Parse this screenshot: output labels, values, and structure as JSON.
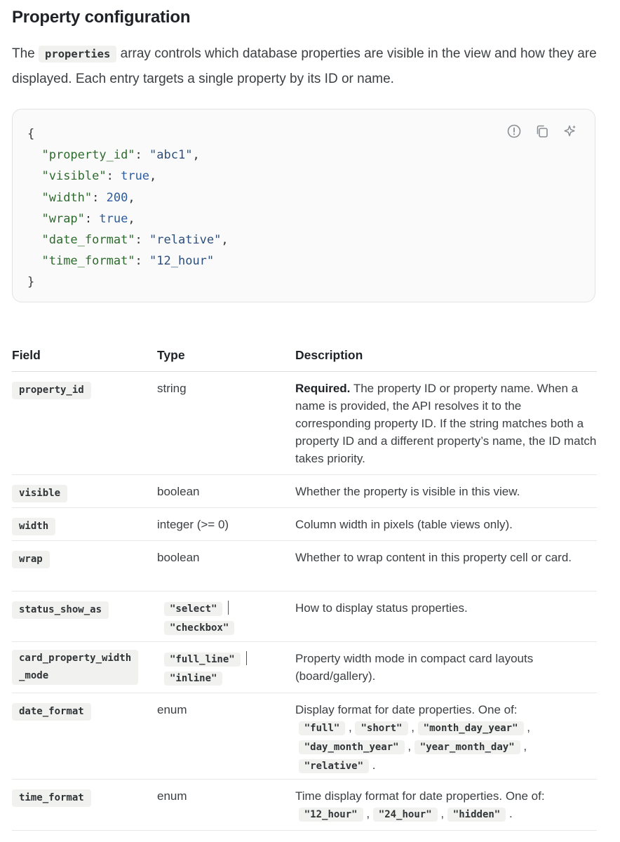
{
  "heading": "Property configuration",
  "intro": {
    "before": "The",
    "code": "properties",
    "after": "array controls which database properties are visible in the view and how they are displayed. Each entry targets a single property by its ID or name."
  },
  "code_block": {
    "open": "{",
    "close": "}",
    "lines": [
      {
        "key": "\"property_id\"",
        "value": "\"abc1\"",
        "type": "string",
        "comma": ","
      },
      {
        "key": "\"visible\"",
        "value": "true",
        "type": "number",
        "comma": ","
      },
      {
        "key": "\"width\"",
        "value": "200",
        "type": "number",
        "comma": ","
      },
      {
        "key": "\"wrap\"",
        "value": "true",
        "type": "number",
        "comma": ","
      },
      {
        "key": "\"date_format\"",
        "value": "\"relative\"",
        "type": "string",
        "comma": ","
      },
      {
        "key": "\"time_format\"",
        "value": "\"12_hour\"",
        "type": "string",
        "comma": ""
      }
    ],
    "icons": [
      "info-icon",
      "copy-icon",
      "sparkle-icon"
    ]
  },
  "table": {
    "headers": {
      "field": "Field",
      "type": "Type",
      "description": "Description"
    },
    "rows": {
      "property_id": {
        "field": "property_id",
        "type": "string",
        "required": "Required.",
        "description": "The property ID or property name. When a name is provided, the API resolves it to the corresponding property ID. If the string matches both a property ID and a different property’s name, the ID match takes priority."
      },
      "visible": {
        "field": "visible",
        "type": "boolean",
        "description": "Whether the property is visible in this view."
      },
      "width": {
        "field": "width",
        "type": "integer (>= 0)",
        "description": "Column width in pixels (table views only)."
      },
      "wrap": {
        "field": "wrap",
        "type": "boolean",
        "description": "Whether to wrap content in this property cell or card."
      },
      "status_show_as": {
        "field": "status_show_as",
        "type_a": "\"select\"",
        "type_b": "\"checkbox\"",
        "description": "How to display status properties."
      },
      "card_property_width_mode": {
        "field_a": "card_property_width",
        "field_b": "_mode",
        "type_a": "\"full_line\"",
        "type_b": "\"inline\"",
        "description": "Property width mode in compact card layouts (board/gallery)."
      },
      "date_format": {
        "field": "date_format",
        "type": "enum",
        "description": "Display format for date properties. One of:",
        "options": [
          "\"full\"",
          "\"short\"",
          "\"month_day_year\"",
          "\"day_month_year\"",
          "\"year_month_day\"",
          "\"relative\""
        ]
      },
      "time_format": {
        "field": "time_format",
        "type": "enum",
        "description": "Time display format for date properties. One of:",
        "options": [
          "\"12_hour\"",
          "\"24_hour\"",
          "\"hidden\""
        ]
      }
    }
  }
}
